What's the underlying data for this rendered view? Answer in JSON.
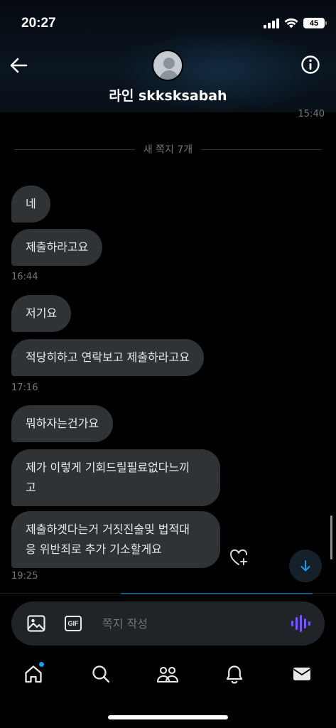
{
  "status": {
    "time": "20:27",
    "battery": "45"
  },
  "header": {
    "name": "라인 skksksabah"
  },
  "conversation": {
    "top_time": "15:40",
    "divider_label": "새 쪽지 7개",
    "groups": [
      {
        "messages": [
          "네",
          "제출하라고요"
        ],
        "time": "16:44"
      },
      {
        "messages": [
          "저기요",
          "적당히하고 연락보고 제출하라고요"
        ],
        "time": "17:16"
      },
      {
        "messages": [
          "뭐하자는건가요",
          "제가 이렇게 기회드릴필료없다느끼고",
          "제출하겟다는거 거짓진술및 법적대응 위반죄로 추가 기소할게요"
        ],
        "time": "19:25"
      }
    ],
    "lines": {
      "m6_l1": "제가 이렇게 기회드릴필료없다느끼",
      "m6_l2": "고",
      "m7_l1": "제출하겟다는거 거짓진술및 법적대",
      "m7_l2": "응 위반죄로 추가 기소할게요"
    }
  },
  "composer": {
    "placeholder": "쪽지 작성",
    "gif_label": "GIF"
  },
  "tabs": [
    "home-icon",
    "search-icon",
    "communities-icon",
    "notifications-icon",
    "messages-icon"
  ],
  "colors": {
    "accent": "#1d9bf0",
    "bubble": "#2f3336",
    "voice": "#7856ff"
  }
}
